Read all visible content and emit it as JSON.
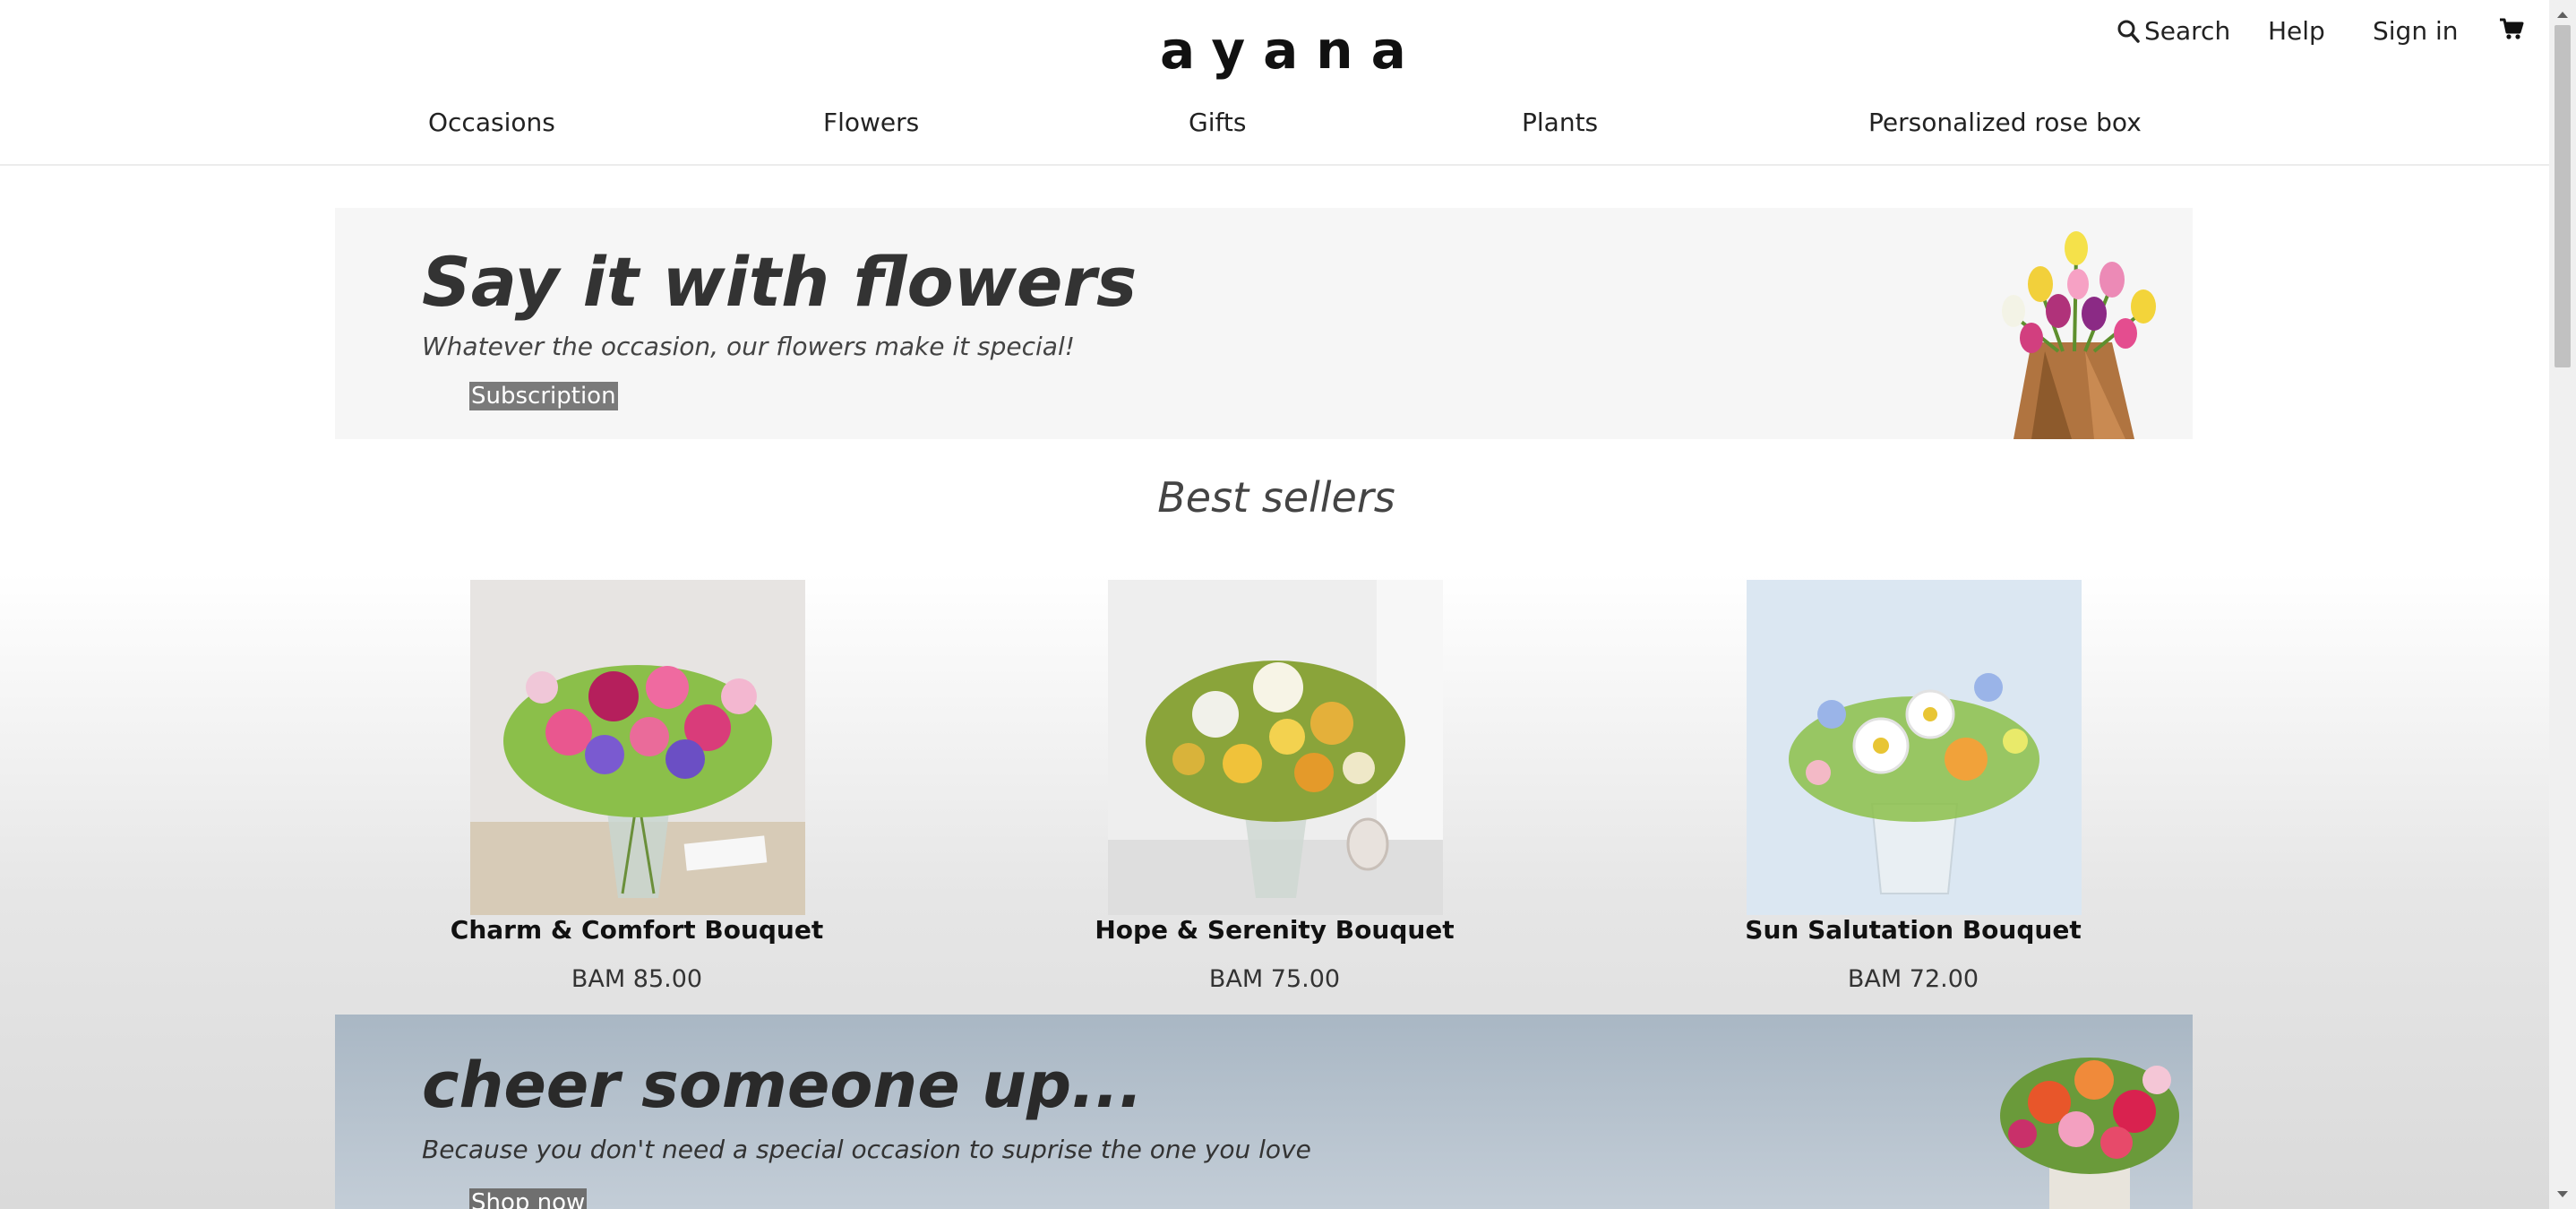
{
  "header": {
    "logo": "ayana",
    "utility": {
      "search_label": "Search",
      "help_label": "Help",
      "signin_label": "Sign in"
    },
    "nav": [
      {
        "label": "Occasions"
      },
      {
        "label": "Flowers"
      },
      {
        "label": "Gifts"
      },
      {
        "label": "Plants"
      },
      {
        "label": "Personalized rose box"
      }
    ]
  },
  "hero": {
    "title": "Say it with flowers",
    "subtitle": "Whatever the occasion, our flowers make it special!",
    "button_label": "Subscription"
  },
  "best_sellers": {
    "title": "Best sellers",
    "products": [
      {
        "name": "Charm & Comfort Bouquet",
        "price": "BAM 85.00"
      },
      {
        "name": "Hope & Serenity Bouquet",
        "price": "BAM 75.00"
      },
      {
        "name": "Sun Salutation Bouquet",
        "price": "BAM 72.00"
      }
    ]
  },
  "promo": {
    "title": "cheer someone up...",
    "subtitle": "Because you don't need a special occasion to suprise the one you love",
    "button_label": "Shop now"
  },
  "icons": {
    "search": "search-icon",
    "cart": "cart-icon"
  },
  "colors": {
    "button_bg": "#7a7a7a",
    "hero_bg": "#f6f6f6",
    "promo_bg": "#b6c2cd"
  }
}
